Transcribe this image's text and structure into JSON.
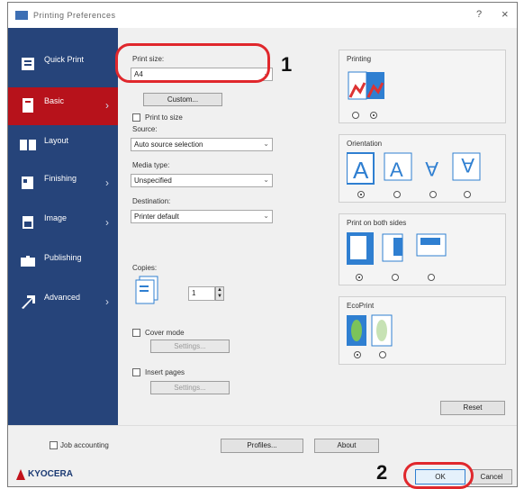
{
  "window": {
    "title": "Printing Preferences",
    "help": "?",
    "close": "×"
  },
  "sidebar": {
    "items": [
      {
        "label": "Quick Print",
        "icon": "quick-print-icon",
        "active": false,
        "chevron": false
      },
      {
        "label": "Basic",
        "icon": "basic-icon",
        "active": true,
        "chevron": true
      },
      {
        "label": "Layout",
        "icon": "layout-icon",
        "active": false,
        "chevron": false
      },
      {
        "label": "Finishing",
        "icon": "finishing-icon",
        "active": false,
        "chevron": true
      },
      {
        "label": "Image",
        "icon": "image-icon",
        "active": false,
        "chevron": true
      },
      {
        "label": "Publishing",
        "icon": "publishing-icon",
        "active": false,
        "chevron": false
      },
      {
        "label": "Advanced",
        "icon": "advanced-icon",
        "active": false,
        "chevron": true
      }
    ]
  },
  "basic": {
    "print_size_label": "Print size:",
    "print_size_value": "A4",
    "custom_btn": "Custom...",
    "print_to_size_label": "Print to size",
    "source_label": "Source:",
    "source_value": "Auto source selection",
    "media_type_label": "Media type:",
    "media_type_value": "Unspecified",
    "destination_label": "Destination:",
    "destination_value": "Printer default",
    "copies_label": "Copies:",
    "copies_value": "1",
    "cover_chk": "Cover mode",
    "cover_btn": "Settings...",
    "insert_chk": "Insert pages",
    "insert_btn": "Settings...",
    "orientation_title": "Orientation",
    "duplex_title": "Print on both sides",
    "reset_btn": "Reset"
  },
  "footer": {
    "job_info_chk": "Job accounting",
    "profile_btn": "Profiles...",
    "about_btn": "About",
    "brand": "KYOCERA",
    "ok_btn": "OK",
    "cancel_btn": "Cancel"
  },
  "callouts": {
    "one": "1",
    "two": "2"
  },
  "colors": {
    "sidebar": "#26447a",
    "active": "#b7121b",
    "callout": "#e0272c"
  }
}
